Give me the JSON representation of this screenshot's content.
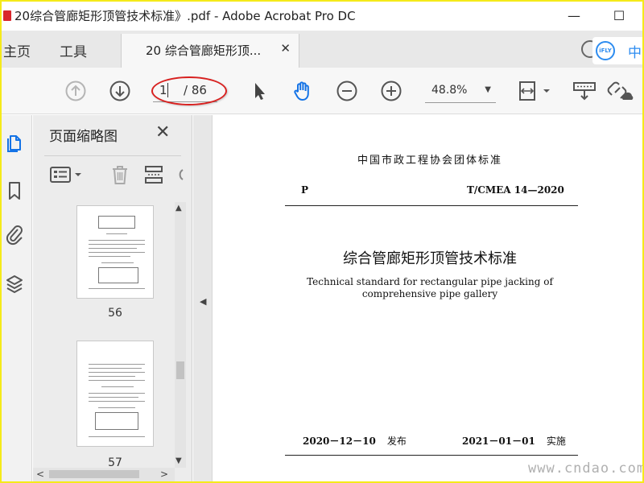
{
  "window": {
    "title": "20综合管廊矩形顶管技术标准》.pdf - Adobe Acrobat Pro DC",
    "minimize_glyph": "—",
    "maximize_glyph": "☐"
  },
  "tabs": {
    "home": "主页",
    "tools": "工具",
    "document": "20 综合管廊矩形顶...",
    "close_glyph": "✕"
  },
  "ifly": {
    "badge": "iFLY",
    "text": "中"
  },
  "toolbar": {
    "page_current": "1",
    "page_total": "/ 86",
    "zoom": "48.8%",
    "zoom_arrow": "▼"
  },
  "panel": {
    "title": "页面缩略图",
    "close_glyph": "✕",
    "thumbnails": [
      {
        "page": "56"
      },
      {
        "page": "57"
      }
    ]
  },
  "scroll": {
    "up": "▲",
    "down": "▼",
    "left": "<",
    "right": ">"
  },
  "collapse_arrow": "◀",
  "document": {
    "association": "中国市政工程协会团体标准",
    "category": "P",
    "standard_no": "T/CMEA 14—2020",
    "title_cn": "综合管廊矩形顶管技术标准",
    "title_en_line1": "Technical standard for rectangular pipe jacking of",
    "title_en_line2": "comprehensive pipe gallery",
    "publish_date": "2020－12－10",
    "publish_label": "发布",
    "implement_date": "2021－01－01",
    "implement_label": "实施"
  },
  "watermark": "www.cndao.com",
  "colors": {
    "border": "#f5ea1a",
    "accent_blue": "#1473e6",
    "annotation_red": "#d8201f",
    "pdf_red": "#d9262c"
  }
}
